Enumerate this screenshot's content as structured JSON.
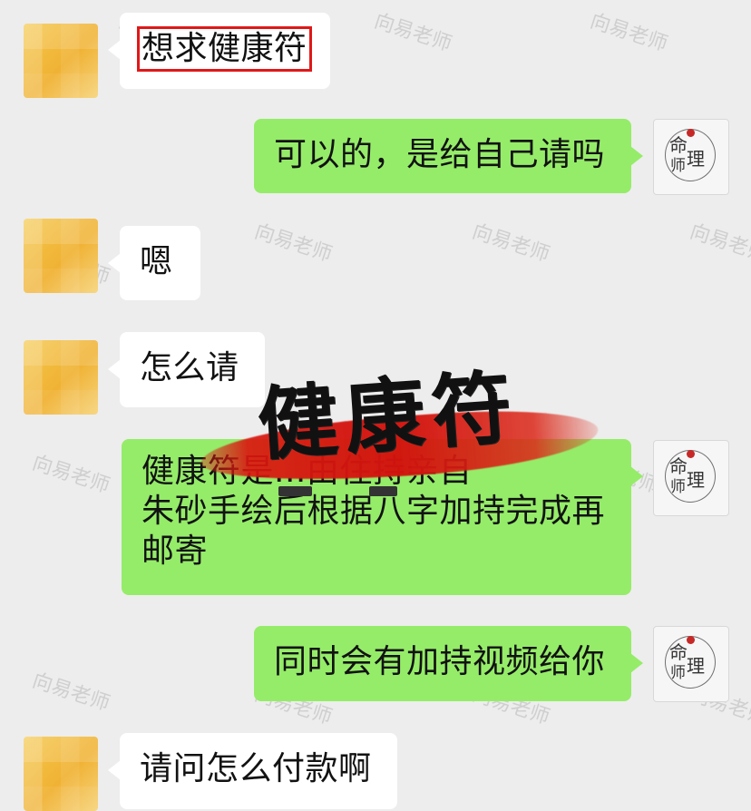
{
  "watermark": "向易老师",
  "messages": [
    {
      "id": "m1",
      "side": "left",
      "text": "想求健康符"
    },
    {
      "id": "m2",
      "side": "right",
      "text": "可以的，是给自己请吗"
    },
    {
      "id": "m3",
      "side": "left",
      "text": "嗯"
    },
    {
      "id": "m4",
      "side": "left",
      "text": "怎么请"
    },
    {
      "id": "m5",
      "side": "right",
      "line1": "健康符是...由住持亲自",
      "line2": "朱砂手绘后根据八字加持完成再",
      "line3": "邮寄"
    },
    {
      "id": "m6",
      "side": "right",
      "text": "同时会有加持视频给你"
    },
    {
      "id": "m7",
      "side": "left",
      "text": "请问怎么付款啊"
    }
  ],
  "overlay": {
    "title": "健康符"
  },
  "brand_avatar": {
    "glyph1": "命",
    "glyph2": "理",
    "glyph3": "师"
  },
  "colors": {
    "background": "#ededed",
    "bubble_left": "#ffffff",
    "bubble_right": "#95ec69",
    "highlight": "#e01818",
    "brush": "#d71910"
  }
}
